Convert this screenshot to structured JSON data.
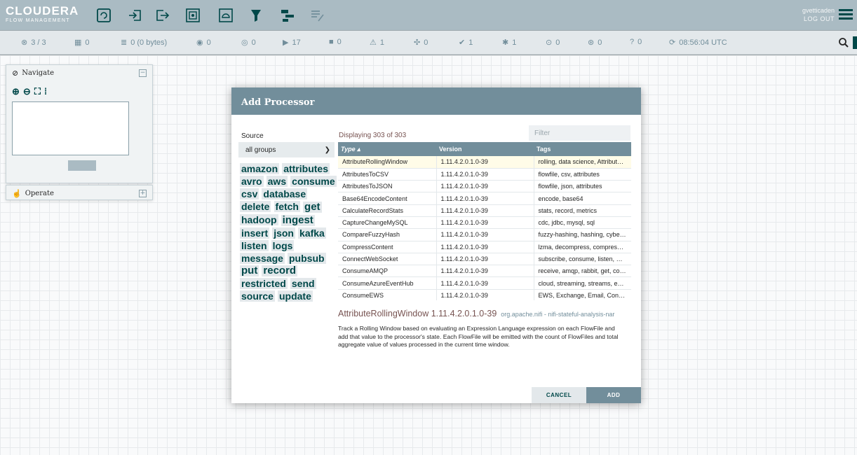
{
  "header": {
    "logo_main": "CLOUDERA",
    "logo_sub": "FLOW MANAGEMENT",
    "user": "gvetticaden",
    "logout": "LOG OUT",
    "toolbar": [
      "processor-icon",
      "input-port-icon",
      "output-port-icon",
      "process-group-icon",
      "remote-process-group-icon",
      "funnel-icon",
      "template-icon",
      "label-icon"
    ]
  },
  "status": {
    "cluster": "3 / 3",
    "threads": "0",
    "queued": "0 (0 bytes)",
    "transmitting": "0",
    "not_transmitting": "0",
    "running": "17",
    "stopped": "0",
    "invalid": "1",
    "disabled": "0",
    "up_to_date": "1",
    "locally_modified": "1",
    "stale": "0",
    "modified_stale": "0",
    "sync_failure": "0",
    "refreshed": "08:56:04 UTC"
  },
  "palettes": {
    "navigate": "Navigate",
    "operate": "Operate"
  },
  "dialog": {
    "title": "Add Processor",
    "source_label": "Source",
    "source_value": "all groups",
    "displaying": "Displaying 303 of 303",
    "filter_placeholder": "Filter",
    "columns": [
      "Type ▴",
      "Version",
      "Tags"
    ],
    "tags": [
      "amazon",
      "attributes",
      "avro",
      "aws",
      "consume",
      "csv",
      "database",
      "delete",
      "fetch",
      "get",
      "hadoop",
      "ingest",
      "insert",
      "json",
      "kafka",
      "listen",
      "logs",
      "message",
      "pubsub",
      "put",
      "record",
      "restricted",
      "send",
      "source",
      "update"
    ],
    "rows": [
      {
        "type": "AttributeRollingWindow",
        "version": "1.11.4.2.0.1.0-39",
        "tags": "rolling, data science, Attribute E..."
      },
      {
        "type": "AttributesToCSV",
        "version": "1.11.4.2.0.1.0-39",
        "tags": "flowfile, csv, attributes"
      },
      {
        "type": "AttributesToJSON",
        "version": "1.11.4.2.0.1.0-39",
        "tags": "flowfile, json, attributes"
      },
      {
        "type": "Base64EncodeContent",
        "version": "1.11.4.2.0.1.0-39",
        "tags": "encode, base64"
      },
      {
        "type": "CalculateRecordStats",
        "version": "1.11.4.2.0.1.0-39",
        "tags": "stats, record, metrics"
      },
      {
        "type": "CaptureChangeMySQL",
        "version": "1.11.4.2.0.1.0-39",
        "tags": "cdc, jdbc, mysql, sql"
      },
      {
        "type": "CompareFuzzyHash",
        "version": "1.11.4.2.0.1.0-39",
        "tags": "fuzzy-hashing, hashing, cyber-s..."
      },
      {
        "type": "CompressContent",
        "version": "1.11.4.2.0.1.0-39",
        "tags": "lzma, decompress, compress, s..."
      },
      {
        "type": "ConnectWebSocket",
        "version": "1.11.4.2.0.1.0-39",
        "tags": "subscribe, consume, listen, We..."
      },
      {
        "type": "ConsumeAMQP",
        "version": "1.11.4.2.0.1.0-39",
        "tags": "receive, amqp, rabbit, get, cons..."
      },
      {
        "type": "ConsumeAzureEventHub",
        "version": "1.11.4.2.0.1.0-39",
        "tags": "cloud, streaming, streams, even..."
      },
      {
        "type": "ConsumeEWS",
        "version": "1.11.4.2.0.1.0-39",
        "tags": "EWS, Exchange, Email, Consum..."
      }
    ],
    "selected_name": "AttributeRollingWindow 1.11.4.2.0.1.0-39",
    "selected_artifact": "org.apache.nifi - nifi-stateful-analysis-nar",
    "selected_description": "Track a Rolling Window based on evaluating an Expression Language expression on each FlowFile and add that value to the processor's state. Each FlowFile will be emitted with the count of FlowFiles and total aggregate value of values processed in the current time window.",
    "cancel": "CANCEL",
    "add": "ADD"
  }
}
